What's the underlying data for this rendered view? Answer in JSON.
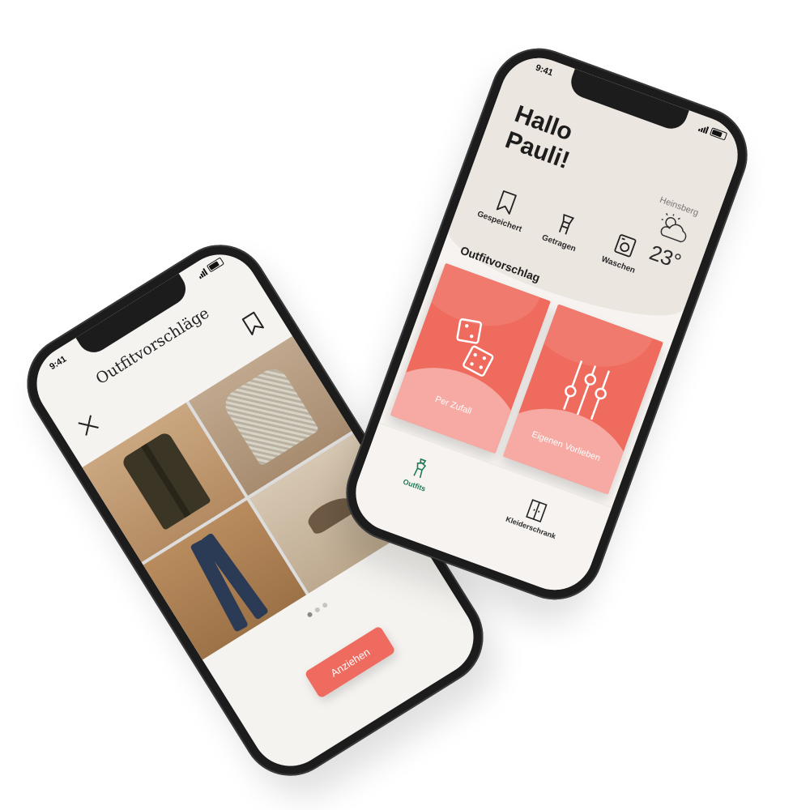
{
  "left_screen": {
    "status_time": "9:41",
    "title": "Outfitvorschläge",
    "close_icon": "close-icon",
    "bookmark_icon": "bookmark-icon",
    "pager_dots": 3,
    "pager_active_index": 0,
    "primary_button_label": "Anziehen",
    "accent_color": "#ef6a5f"
  },
  "right_screen": {
    "status_time": "9:41",
    "greeting": "Hallo Pauli!",
    "weather": {
      "city": "Heinsberg",
      "temperature": "23°",
      "icon": "partly-cloudy-icon"
    },
    "actions": [
      {
        "label": "Gespeichert",
        "icon": "bookmark-icon"
      },
      {
        "label": "Getragen",
        "icon": "hanger-icon"
      },
      {
        "label": "Waschen",
        "icon": "washing-machine-icon"
      }
    ],
    "section_title": "Outfitvorschlag",
    "cards": [
      {
        "label": "Per Zufall",
        "icon": "dice-icon"
      },
      {
        "label": "Eigenen Vorlieben",
        "icon": "sliders-icon"
      }
    ],
    "tabs": [
      {
        "label": "Outfits",
        "icon": "outfit-icon",
        "active": true
      },
      {
        "label": "Kleiderschrank",
        "icon": "wardrobe-icon",
        "active": false
      }
    ],
    "accent_color": "#ef6b5e",
    "active_tab_color": "#1f7a58"
  }
}
